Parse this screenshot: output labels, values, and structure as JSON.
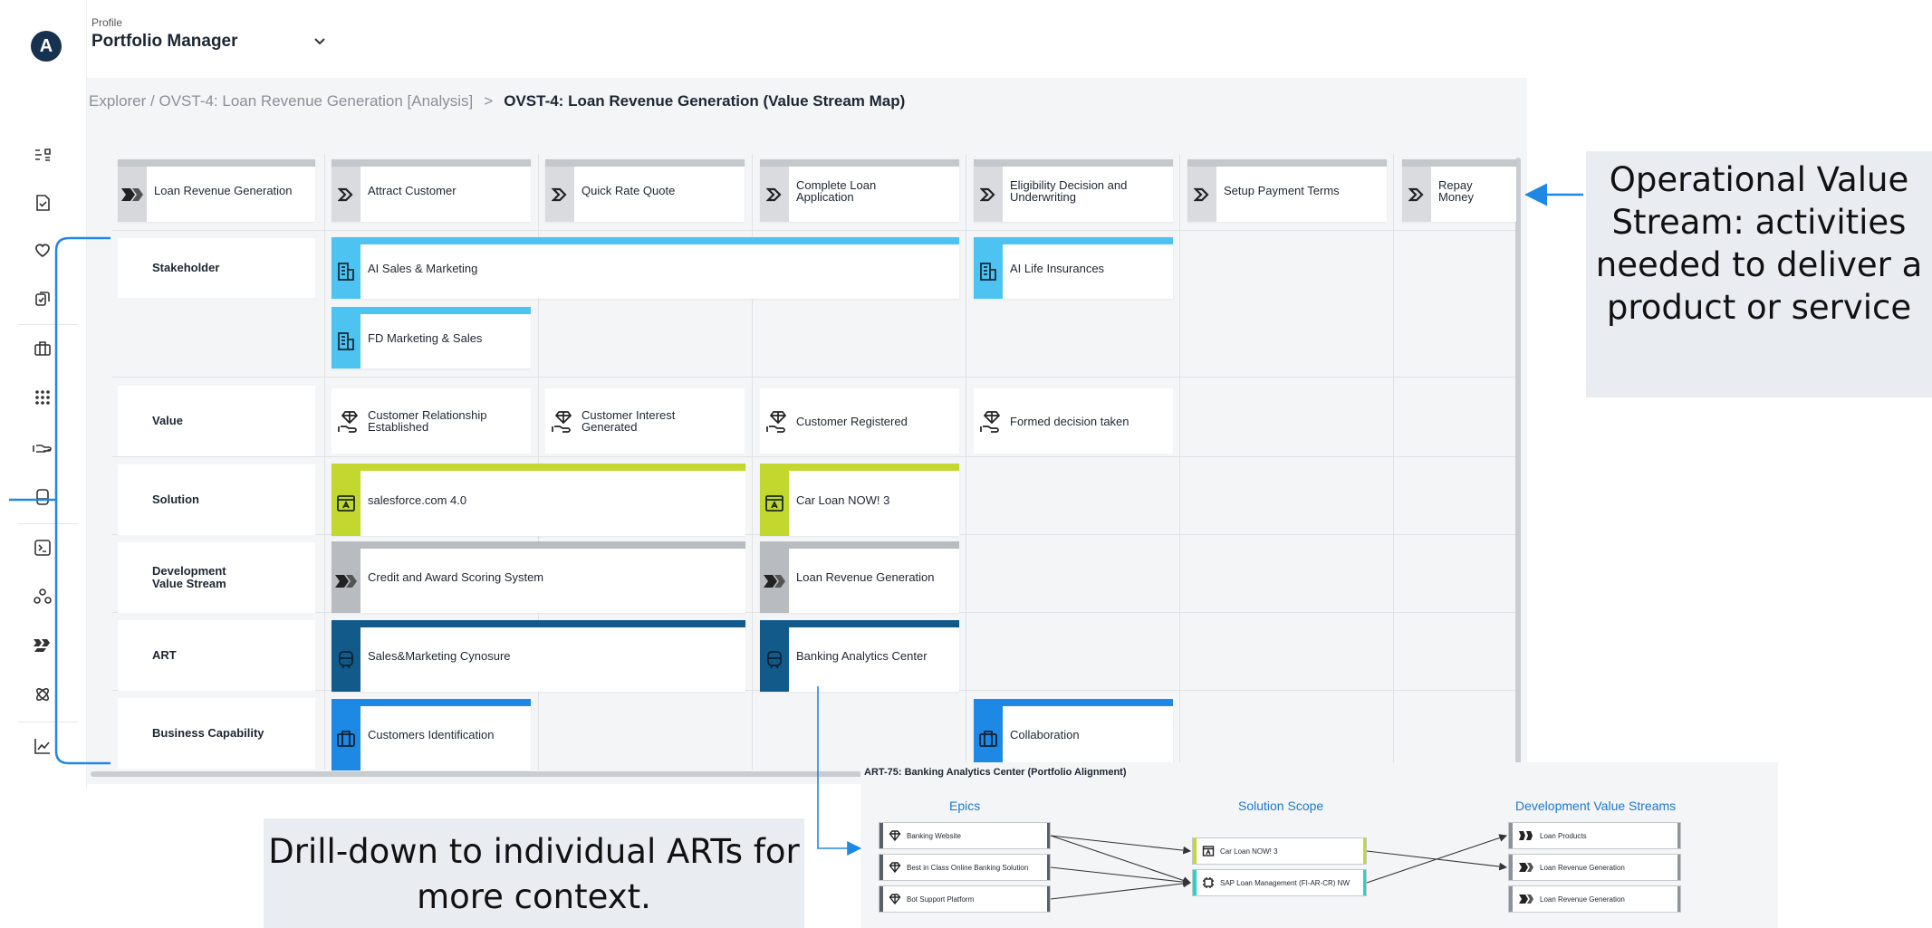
{
  "app": {
    "avatar_letter": "A"
  },
  "header": {
    "profile_label": "Profile",
    "profile_value": "Portfolio Manager"
  },
  "breadcrumb": {
    "parent": "Explorer / OVST-4: Loan Revenue Generation [Analysis]",
    "separator": ">",
    "current": "OVST-4: Loan Revenue Generation (Value Stream Map)"
  },
  "steps": [
    {
      "label": "Loan Revenue Generation",
      "icon": "value-stream-icon"
    },
    {
      "label": "Attract Customer",
      "icon": "step-icon"
    },
    {
      "label": "Quick Rate Quote",
      "icon": "step-icon"
    },
    {
      "label": "Complete Loan Application",
      "icon": "step-icon"
    },
    {
      "label": "Eligibility Decision and Underwriting",
      "icon": "step-icon"
    },
    {
      "label": "Setup Payment Terms",
      "icon": "step-icon"
    },
    {
      "label": "Repay Money",
      "icon": "step-icon"
    }
  ],
  "rows": [
    "Stakeholder",
    "Value",
    "Solution",
    "Development Value Stream",
    "ART",
    "Business Capability"
  ],
  "stakeholders": [
    "AI Sales & Marketing",
    "AI Life Insurances",
    "FD Marketing & Sales"
  ],
  "values": [
    "Customer Relationship Established",
    "Customer Interest Generated",
    "Customer Registered",
    "Formed decision taken"
  ],
  "solutions": [
    "salesforce.com 4.0",
    "Car Loan NOW! 3"
  ],
  "dev_value_streams": [
    "Credit and Award Scoring System",
    "Loan Revenue Generation"
  ],
  "arts": [
    "Sales&Marketing Cynosure",
    "Banking Analytics Center"
  ],
  "capabilities": [
    "Customers Identification",
    "Collaboration"
  ],
  "callouts": {
    "right": "Operational Value Stream: activities needed to deliver a product or service",
    "bottom": "Drill-down to individual ARTs for more context."
  },
  "drill": {
    "title": "ART-75: Banking Analytics Center (Portfolio Alignment)",
    "heads": [
      "Epics",
      "Solution Scope",
      "Development Value Streams"
    ],
    "epics": [
      "Banking Website",
      "Best in Class Online Banking Solution",
      "Bot Support Platform"
    ],
    "solutions": [
      "Car Loan NOW! 3",
      "SAP Loan Management (FI-AR-CR) NW"
    ],
    "dvs": [
      "Loan Products",
      "Loan Revenue Generation",
      "Loan Revenue Generation"
    ]
  },
  "colors": {
    "stakeholder": "#4cc3f0",
    "solution": "#c3d82e",
    "art": "#125a8a",
    "capability": "#1e88e5",
    "dvs": "#b8bbbf",
    "step_bar": "#c4c7cb",
    "drill_solution_bar": "#c3d82e",
    "drill_sap_bar": "#27d3c3",
    "arrow": "#1e88e5"
  }
}
